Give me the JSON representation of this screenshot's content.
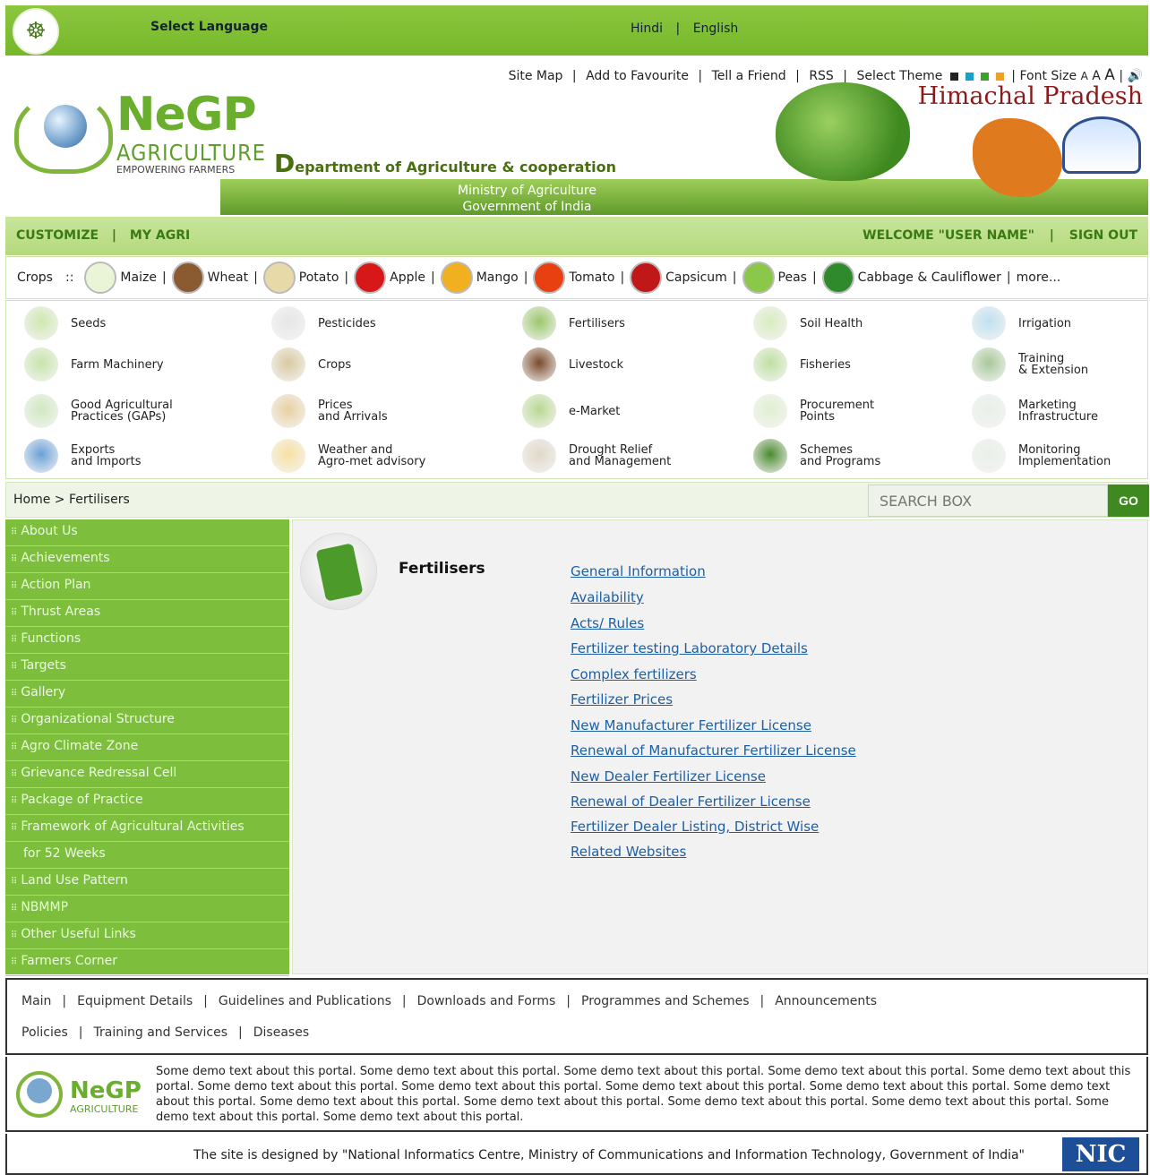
{
  "topbar": {
    "select_language": "Select Language",
    "hindi": "Hindi",
    "sep": "|",
    "english": "English"
  },
  "util": {
    "site_map": "Site Map",
    "add_fav": "Add to Favourite",
    "tell_friend": "Tell a Friend",
    "rss": "RSS",
    "select_theme": "Select Theme",
    "font_size": "Font Size",
    "font_a1": "A",
    "font_a2": "A",
    "font_a3": "A",
    "theme_colors": [
      "#222222",
      "#1aa1c8",
      "#3aa32a",
      "#f0a020"
    ]
  },
  "header": {
    "logo_ngp": "NeGP",
    "logo_agri": "AGRICULTURE",
    "logo_tag": "EMPOWERING FARMERS",
    "dept": "Department of Agriculture & cooperation",
    "ministry_1": "Ministry of Agriculture",
    "ministry_2": "Government of India",
    "state": "Himachal Pradesh"
  },
  "nav": {
    "customize": "CUSTOMIZE",
    "my_agri": "MY AGRI",
    "welcome": "WELCOME \"USER NAME\"",
    "sign_out": "SIGN OUT"
  },
  "crops": {
    "label": "Crops",
    "items": [
      "Maize",
      "Wheat",
      "Potato",
      "Apple",
      "Mango",
      "Tomato",
      "Capsicum",
      "Peas",
      "Cabbage & Cauliflower"
    ],
    "more": "more..."
  },
  "categories": [
    {
      "l1": "Seeds",
      "l2": ""
    },
    {
      "l1": "Pesticides",
      "l2": ""
    },
    {
      "l1": "Fertilisers",
      "l2": ""
    },
    {
      "l1": "Soil Health",
      "l2": ""
    },
    {
      "l1": "Irrigation",
      "l2": ""
    },
    {
      "l1": "Farm Machinery",
      "l2": ""
    },
    {
      "l1": "Crops",
      "l2": ""
    },
    {
      "l1": "Livestock",
      "l2": ""
    },
    {
      "l1": "Fisheries",
      "l2": ""
    },
    {
      "l1": "Training",
      "l2": "& Extension"
    },
    {
      "l1": "Good Agricultural",
      "l2": "Practices (GAPs)"
    },
    {
      "l1": "Prices",
      "l2": "and Arrivals"
    },
    {
      "l1": "e-Market",
      "l2": ""
    },
    {
      "l1": "Procurement",
      "l2": "Points"
    },
    {
      "l1": "Marketing",
      "l2": "Infrastructure"
    },
    {
      "l1": "Exports",
      "l2": "and Imports"
    },
    {
      "l1": "Weather and",
      "l2": "Agro-met advisory"
    },
    {
      "l1": "Drought Relief",
      "l2": "and Management"
    },
    {
      "l1": "Schemes",
      "l2": "and Programs"
    },
    {
      "l1": "Monitoring",
      "l2": "Implementation"
    }
  ],
  "breadcrumb": {
    "home": "Home",
    "sep": ">",
    "current": "Fertilisers"
  },
  "search": {
    "placeholder": "SEARCH BOX",
    "go": "GO"
  },
  "sidebar": [
    "About Us",
    "Achievements",
    "Action Plan",
    "Thrust Areas",
    "Functions",
    "Targets",
    "Gallery",
    "Organizational Structure",
    "Agro Climate Zone",
    "Grievance Redressal Cell",
    "Package of Practice",
    "Framework of Agricultural Activities",
    "for 52 Weeks",
    "Land Use Pattern",
    "NBMMP",
    "Other Useful Links",
    "Farmers Corner"
  ],
  "main": {
    "title": "Fertilisers",
    "links": [
      "General Information",
      "Availability",
      "Acts/ Rules",
      "Fertilizer testing Laboratory Details",
      "Complex fertilizers",
      "Fertilizer Prices",
      "New Manufacturer Fertilizer License",
      "Renewal of Manufacturer Fertilizer License",
      "New Dealer Fertilizer License",
      "Renewal of Dealer Fertilizer License",
      "Fertilizer Dealer Listing, District Wise",
      "Related Websites"
    ]
  },
  "footer": {
    "row1": [
      "Main",
      "Equipment Details",
      "Guidelines and Publications",
      "Downloads and Forms",
      "Programmes and Schemes",
      "Announcements"
    ],
    "row2": [
      "Policies",
      "Training and Services",
      "Diseases"
    ],
    "about": "Some demo text about this portal. Some demo text about this portal. Some demo text about this portal. Some demo text about this portal. Some demo text about this portal. Some demo text about this portal. Some demo text about this portal. Some demo text about this portal. Some demo text about this portal. Some demo text about this portal. Some demo text about this portal. Some demo text about this portal. Some demo text about this portal. Some demo text about this portal. Some demo text about this portal. Some demo text about this portal.",
    "credit": "The site is designed by \"National Informatics Centre, Ministry of Communications and Information Technology, Government of India\"",
    "nic": "NIC"
  }
}
